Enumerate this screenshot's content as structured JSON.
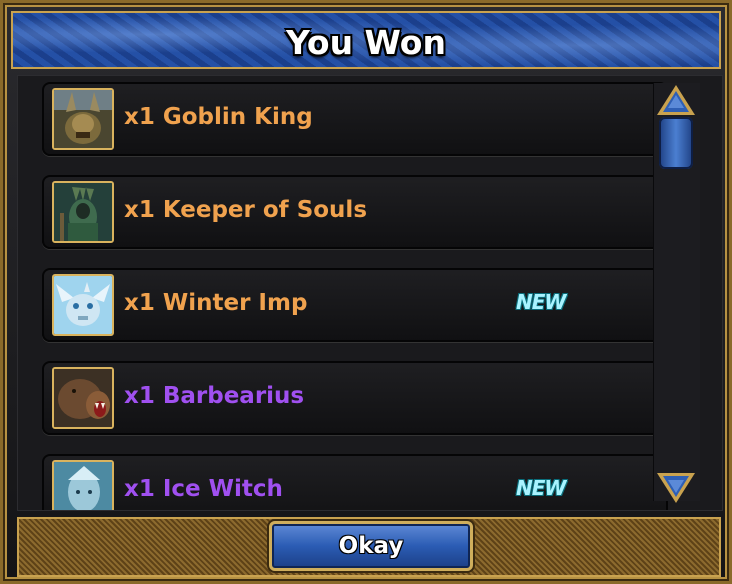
{
  "dialog": {
    "title": "You Won",
    "button_label": "Okay"
  },
  "rewards": [
    {
      "label": "x1 Goblin King",
      "rarity_color": "#f0a24e",
      "is_new": false,
      "portrait": "goblin-king-portrait"
    },
    {
      "label": "x1 Keeper of Souls",
      "rarity_color": "#f0a24e",
      "is_new": false,
      "portrait": "keeper-of-souls-portrait"
    },
    {
      "label": "x1 Winter Imp",
      "rarity_color": "#f0a24e",
      "is_new": true,
      "portrait": "winter-imp-portrait"
    },
    {
      "label": "x1 Barbearius",
      "rarity_color": "#a050f0",
      "is_new": false,
      "portrait": "barbearius-portrait"
    },
    {
      "label": "x1 Ice Witch",
      "rarity_color": "#a050f0",
      "is_new": true,
      "portrait": "ice-witch-portrait"
    }
  ],
  "badge_text": "NEW",
  "scroll_icons": {
    "up": "triangle-up-icon",
    "down": "triangle-down-icon"
  },
  "colors": {
    "title_bar": "#2450a6",
    "frame_gold": "#c9a24f",
    "button_blue": "#2b5cb4"
  }
}
